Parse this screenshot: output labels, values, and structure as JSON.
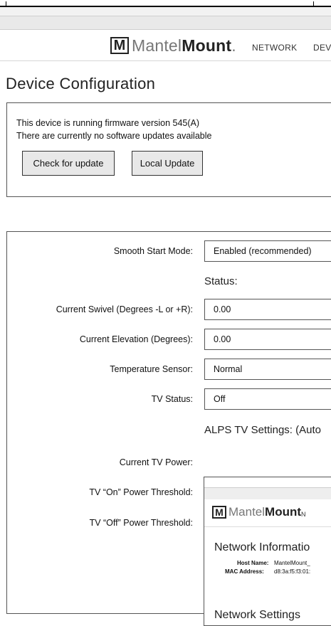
{
  "nav": {
    "brand_light": "Mantel",
    "brand_bold": "Mount",
    "brand_tm": ".",
    "links": [
      "NETWORK",
      "DEV"
    ]
  },
  "page": {
    "title": "Device Configuration"
  },
  "firmware": {
    "line1": "This device is running firmware version 545(A)",
    "line2": "There are currently no software updates available",
    "check_button": "Check for update",
    "local_button": "Local Update"
  },
  "settings": {
    "smooth_start_label": "Smooth Start Mode:",
    "smooth_start_value": "Enabled (recommended)",
    "status_heading": "Status:",
    "swivel_label": "Current Swivel (Degrees -L or +R):",
    "swivel_value": "0.00",
    "elevation_label": "Current Elevation (Degrees):",
    "elevation_value": "0.00",
    "temp_label": "Temperature Sensor:",
    "temp_value": "Normal",
    "tv_status_label": "TV Status:",
    "tv_status_value": "Off",
    "alps_heading": "ALPS TV Settings:  (Auto",
    "tv_power_label": "Current TV Power:",
    "on_threshold_label": "TV “On”  Power Threshold:",
    "off_threshold_label": "TV “Off”  Power Threshold:"
  },
  "inner": {
    "brand_light": "Mantel",
    "brand_bold": "Mount",
    "nav_letter": "N",
    "title": "Network Informatio",
    "host_label": "Host Name:",
    "host_value": "MantelMount_",
    "mac_label": "MAC Address:",
    "mac_value": "d8:3a:f5:f3:01:",
    "settings_title": "Network Settings"
  }
}
